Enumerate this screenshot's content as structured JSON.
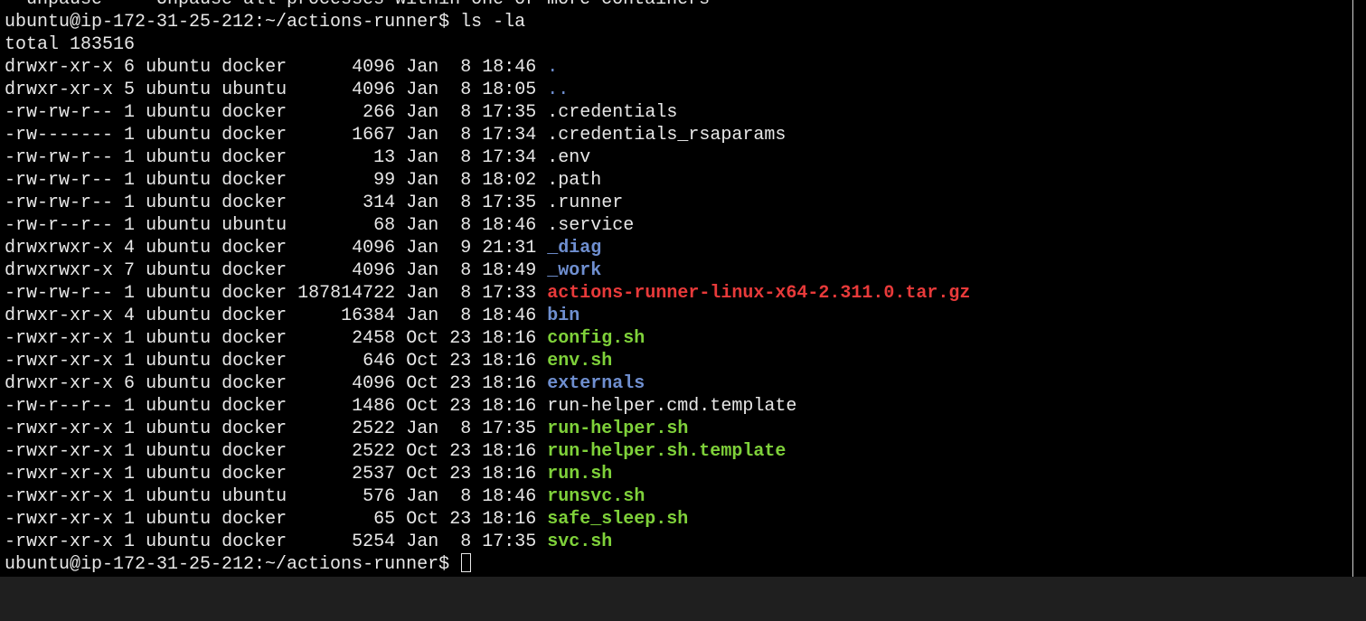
{
  "terminal": {
    "top_partial_line": "  unpause     Unpause all processes within one or more containers",
    "prompt": "ubuntu@ip-172-31-25-212:~/actions-runner$",
    "command": "ls -la",
    "total_line": "total 183516",
    "colors": {
      "directory": "#6f8fd0",
      "executable": "#7fd13a",
      "archive": "#e83a3a",
      "text": "#e8e8e8",
      "background": "#000000"
    },
    "entries": [
      {
        "perms": "drwxr-xr-x",
        "links": "6",
        "owner": "ubuntu",
        "group": "docker",
        "size": "4096",
        "month": "Jan",
        "day": "8",
        "time": "18:46",
        "name": ".",
        "kind": "dot"
      },
      {
        "perms": "drwxr-xr-x",
        "links": "5",
        "owner": "ubuntu",
        "group": "ubuntu",
        "size": "4096",
        "month": "Jan",
        "day": "8",
        "time": "18:05",
        "name": "..",
        "kind": "dot"
      },
      {
        "perms": "-rw-rw-r--",
        "links": "1",
        "owner": "ubuntu",
        "group": "docker",
        "size": "266",
        "month": "Jan",
        "day": "8",
        "time": "17:35",
        "name": ".credentials",
        "kind": "plain"
      },
      {
        "perms": "-rw-------",
        "links": "1",
        "owner": "ubuntu",
        "group": "docker",
        "size": "1667",
        "month": "Jan",
        "day": "8",
        "time": "17:34",
        "name": ".credentials_rsaparams",
        "kind": "plain"
      },
      {
        "perms": "-rw-rw-r--",
        "links": "1",
        "owner": "ubuntu",
        "group": "docker",
        "size": "13",
        "month": "Jan",
        "day": "8",
        "time": "17:34",
        "name": ".env",
        "kind": "plain"
      },
      {
        "perms": "-rw-rw-r--",
        "links": "1",
        "owner": "ubuntu",
        "group": "docker",
        "size": "99",
        "month": "Jan",
        "day": "8",
        "time": "18:02",
        "name": ".path",
        "kind": "plain"
      },
      {
        "perms": "-rw-rw-r--",
        "links": "1",
        "owner": "ubuntu",
        "group": "docker",
        "size": "314",
        "month": "Jan",
        "day": "8",
        "time": "17:35",
        "name": ".runner",
        "kind": "plain"
      },
      {
        "perms": "-rw-r--r--",
        "links": "1",
        "owner": "ubuntu",
        "group": "ubuntu",
        "size": "68",
        "month": "Jan",
        "day": "8",
        "time": "18:46",
        "name": ".service",
        "kind": "plain"
      },
      {
        "perms": "drwxrwxr-x",
        "links": "4",
        "owner": "ubuntu",
        "group": "docker",
        "size": "4096",
        "month": "Jan",
        "day": "9",
        "time": "21:31",
        "name": "_diag",
        "kind": "dir"
      },
      {
        "perms": "drwxrwxr-x",
        "links": "7",
        "owner": "ubuntu",
        "group": "docker",
        "size": "4096",
        "month": "Jan",
        "day": "8",
        "time": "18:49",
        "name": "_work",
        "kind": "dir"
      },
      {
        "perms": "-rw-rw-r--",
        "links": "1",
        "owner": "ubuntu",
        "group": "docker",
        "size": "187814722",
        "month": "Jan",
        "day": "8",
        "time": "17:33",
        "name": "actions-runner-linux-x64-2.311.0.tar.gz",
        "kind": "arc"
      },
      {
        "perms": "drwxr-xr-x",
        "links": "4",
        "owner": "ubuntu",
        "group": "docker",
        "size": "16384",
        "month": "Jan",
        "day": "8",
        "time": "18:46",
        "name": "bin",
        "kind": "dir"
      },
      {
        "perms": "-rwxr-xr-x",
        "links": "1",
        "owner": "ubuntu",
        "group": "docker",
        "size": "2458",
        "month": "Oct",
        "day": "23",
        "time": "18:16",
        "name": "config.sh",
        "kind": "exe"
      },
      {
        "perms": "-rwxr-xr-x",
        "links": "1",
        "owner": "ubuntu",
        "group": "docker",
        "size": "646",
        "month": "Oct",
        "day": "23",
        "time": "18:16",
        "name": "env.sh",
        "kind": "exe"
      },
      {
        "perms": "drwxr-xr-x",
        "links": "6",
        "owner": "ubuntu",
        "group": "docker",
        "size": "4096",
        "month": "Oct",
        "day": "23",
        "time": "18:16",
        "name": "externals",
        "kind": "dir"
      },
      {
        "perms": "-rw-r--r--",
        "links": "1",
        "owner": "ubuntu",
        "group": "docker",
        "size": "1486",
        "month": "Oct",
        "day": "23",
        "time": "18:16",
        "name": "run-helper.cmd.template",
        "kind": "plain"
      },
      {
        "perms": "-rwxr-xr-x",
        "links": "1",
        "owner": "ubuntu",
        "group": "docker",
        "size": "2522",
        "month": "Jan",
        "day": "8",
        "time": "17:35",
        "name": "run-helper.sh",
        "kind": "exe"
      },
      {
        "perms": "-rwxr-xr-x",
        "links": "1",
        "owner": "ubuntu",
        "group": "docker",
        "size": "2522",
        "month": "Oct",
        "day": "23",
        "time": "18:16",
        "name": "run-helper.sh.template",
        "kind": "exe"
      },
      {
        "perms": "-rwxr-xr-x",
        "links": "1",
        "owner": "ubuntu",
        "group": "docker",
        "size": "2537",
        "month": "Oct",
        "day": "23",
        "time": "18:16",
        "name": "run.sh",
        "kind": "exe"
      },
      {
        "perms": "-rwxr-xr-x",
        "links": "1",
        "owner": "ubuntu",
        "group": "ubuntu",
        "size": "576",
        "month": "Jan",
        "day": "8",
        "time": "18:46",
        "name": "runsvc.sh",
        "kind": "exe"
      },
      {
        "perms": "-rwxr-xr-x",
        "links": "1",
        "owner": "ubuntu",
        "group": "docker",
        "size": "65",
        "month": "Oct",
        "day": "23",
        "time": "18:16",
        "name": "safe_sleep.sh",
        "kind": "exe"
      },
      {
        "perms": "-rwxr-xr-x",
        "links": "1",
        "owner": "ubuntu",
        "group": "docker",
        "size": "5254",
        "month": "Jan",
        "day": "8",
        "time": "17:35",
        "name": "svc.sh",
        "kind": "exe"
      }
    ]
  }
}
